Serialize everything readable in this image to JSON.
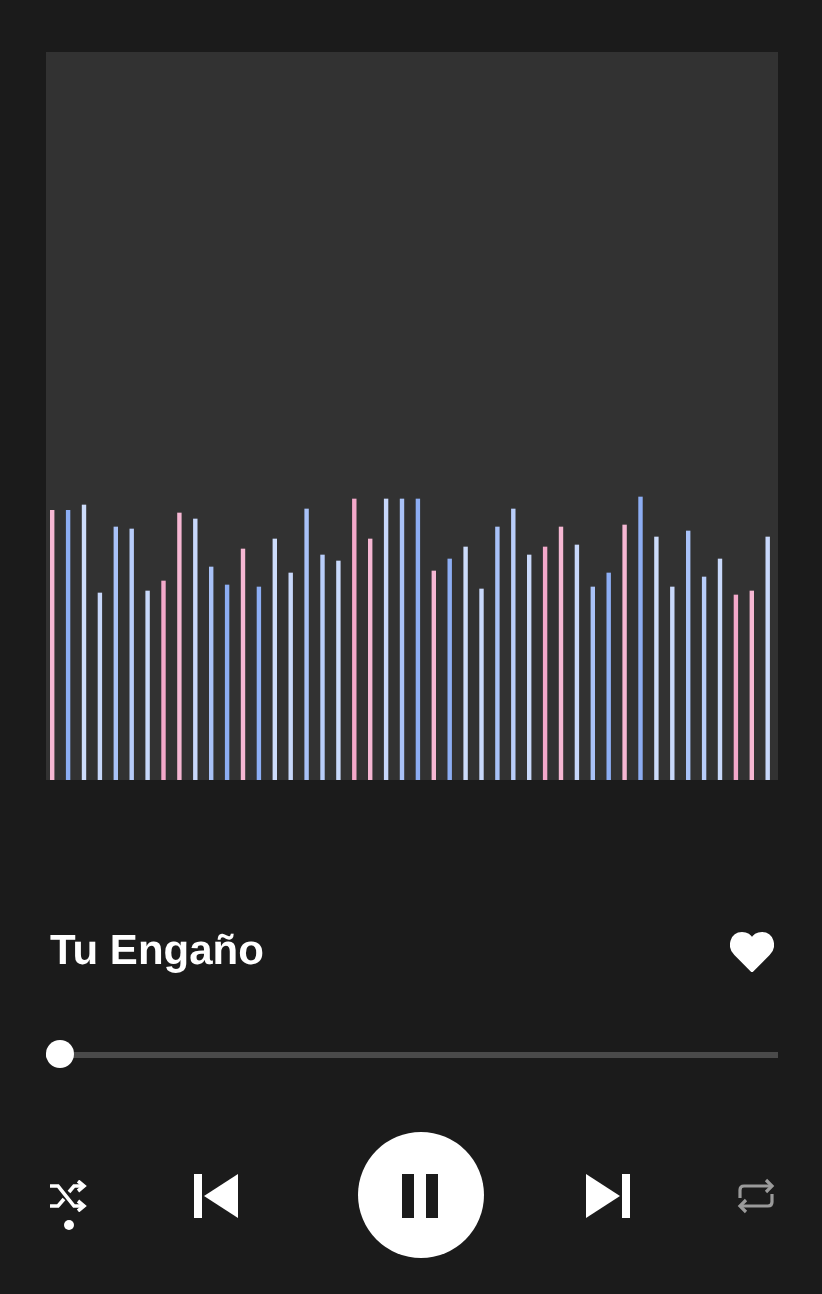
{
  "track": {
    "title": "Tu Engaño",
    "liked": true
  },
  "progress": {
    "level": 0.02
  },
  "controls": {
    "shuffle_on": true,
    "playing": true,
    "repeat_on": false
  }
}
